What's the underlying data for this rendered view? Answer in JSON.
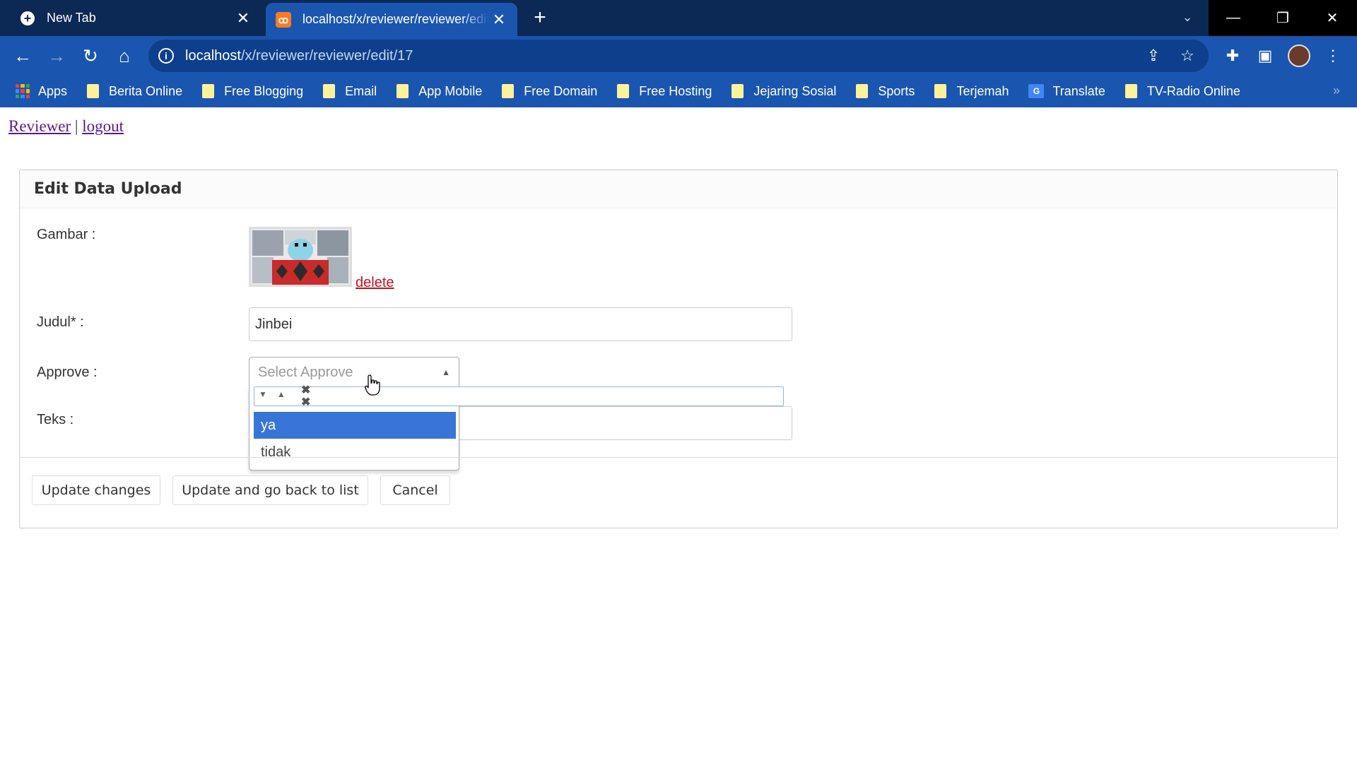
{
  "browser": {
    "tabs": [
      {
        "title": "New Tab",
        "active": false
      },
      {
        "title": "localhost/x/reviewer/reviewer/edit/17",
        "active": true
      }
    ],
    "address": {
      "host": "localhost",
      "path": "/x/reviewer/reviewer/edit/17"
    },
    "bookmarks": [
      {
        "label": "Apps",
        "icon": "apps-grid-icon"
      },
      {
        "label": "Berita Online",
        "icon": "folder-icon"
      },
      {
        "label": "Free Blogging",
        "icon": "folder-icon"
      },
      {
        "label": "Email",
        "icon": "folder-icon"
      },
      {
        "label": "App Mobile",
        "icon": "folder-icon"
      },
      {
        "label": "Free Domain",
        "icon": "folder-icon"
      },
      {
        "label": "Free Hosting",
        "icon": "folder-icon"
      },
      {
        "label": "Jejaring Sosial",
        "icon": "folder-icon"
      },
      {
        "label": "Sports",
        "icon": "folder-icon"
      },
      {
        "label": "Terjemah",
        "icon": "folder-icon"
      },
      {
        "label": "Translate",
        "icon": "google-translate-icon"
      },
      {
        "label": "TV-Radio Online",
        "icon": "folder-icon"
      }
    ]
  },
  "nav": {
    "reviewer": "Reviewer",
    "separator": "|",
    "logout": "logout"
  },
  "form": {
    "heading": "Edit Data Upload",
    "gambar_label": "Gambar :",
    "delete_link": "delete",
    "judul_label": "Judul* :",
    "judul_value": "Jinbei",
    "approve_label": "Approve :",
    "approve_placeholder": "Select Approve",
    "approve_options": [
      "ya",
      "tidak"
    ],
    "approve_highlighted": "ya",
    "teks_label": "Teks :"
  },
  "buttons": {
    "update": "Update changes",
    "update_back": "Update and go back to list",
    "cancel": "Cancel"
  },
  "colors": {
    "tabbar": "#0b2954",
    "toolbar": "#1a56b0",
    "highlight": "#3875d7",
    "delete": "#c1121f"
  }
}
